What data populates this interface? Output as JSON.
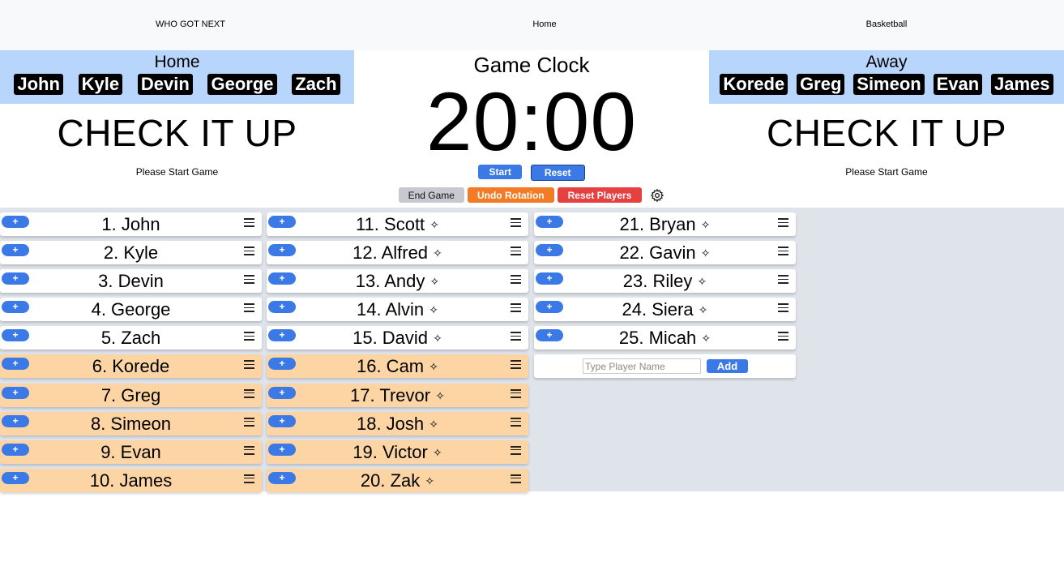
{
  "nav": {
    "brand": "WHO GOT NEXT",
    "home": "Home",
    "sport": "Basketball"
  },
  "home_team": {
    "name": "Home",
    "players": [
      "John",
      "Kyle",
      "Devin",
      "George",
      "Zach"
    ],
    "message": "CHECK IT UP",
    "status": "Please Start Game"
  },
  "away_team": {
    "name": "Away",
    "players": [
      "Korede",
      "Greg",
      "Simeon",
      "Evan",
      "James"
    ],
    "message": "CHECK IT UP",
    "status": "Please Start Game"
  },
  "clock": {
    "title": "Game Clock",
    "time": "20:00",
    "start_label": "Start",
    "reset_label": "Reset",
    "end_game_label": "End Game",
    "undo_rotation_label": "Undo Rotation",
    "reset_players_label": "Reset Players"
  },
  "queue": [
    {
      "label": "1. John",
      "on_court": false,
      "sparkle": false
    },
    {
      "label": "2. Kyle",
      "on_court": false,
      "sparkle": false
    },
    {
      "label": "3. Devin",
      "on_court": false,
      "sparkle": false
    },
    {
      "label": "4. George",
      "on_court": false,
      "sparkle": false
    },
    {
      "label": "5. Zach",
      "on_court": false,
      "sparkle": false
    },
    {
      "label": "6. Korede",
      "on_court": true,
      "sparkle": false
    },
    {
      "label": "7. Greg",
      "on_court": true,
      "sparkle": false
    },
    {
      "label": "8. Simeon",
      "on_court": true,
      "sparkle": false
    },
    {
      "label": "9. Evan",
      "on_court": true,
      "sparkle": false
    },
    {
      "label": "10. James",
      "on_court": true,
      "sparkle": false
    },
    {
      "label": "11. Scott",
      "on_court": false,
      "sparkle": true
    },
    {
      "label": "12. Alfred",
      "on_court": false,
      "sparkle": true
    },
    {
      "label": "13. Andy",
      "on_court": false,
      "sparkle": true
    },
    {
      "label": "14. Alvin",
      "on_court": false,
      "sparkle": true
    },
    {
      "label": "15. David",
      "on_court": false,
      "sparkle": true
    },
    {
      "label": "16. Cam",
      "on_court": true,
      "sparkle": true
    },
    {
      "label": "17. Trevor",
      "on_court": true,
      "sparkle": true
    },
    {
      "label": "18. Josh",
      "on_court": true,
      "sparkle": true
    },
    {
      "label": "19. Victor",
      "on_court": true,
      "sparkle": true
    },
    {
      "label": "20. Zak",
      "on_court": true,
      "sparkle": true
    },
    {
      "label": "21. Bryan",
      "on_court": false,
      "sparkle": true
    },
    {
      "label": "22. Gavin",
      "on_court": false,
      "sparkle": true
    },
    {
      "label": "23. Riley",
      "on_court": false,
      "sparkle": true
    },
    {
      "label": "24. Siera",
      "on_court": false,
      "sparkle": true
    },
    {
      "label": "25. Micah",
      "on_court": false,
      "sparkle": true
    }
  ],
  "plus_label": "+",
  "sparkle_glyph": "✧",
  "add_player": {
    "placeholder": "Type Player Name",
    "button_label": "Add"
  },
  "colors": {
    "accent": "#3b7ae6",
    "team_box": "#b8d5fb",
    "on_court_row": "#fdd5a5",
    "undo": "#f47b25",
    "reset_players": "#e54141"
  }
}
